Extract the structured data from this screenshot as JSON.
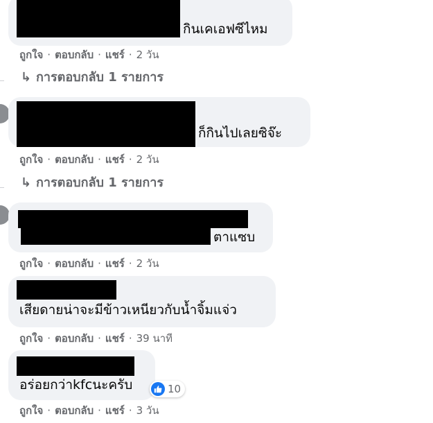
{
  "comments": [
    {
      "text": "กินเคเอฟซีไหม",
      "timestamp": "2 วัน",
      "replies_label": "การตอบกลับ 1 รายการ"
    },
    {
      "text": "ก็กินไปเลยซิจ๊ะ",
      "timestamp": "2 วัน",
      "replies_label": "การตอบกลับ 1 รายการ"
    },
    {
      "text": "ตาแซบ",
      "timestamp": "2 วัน"
    },
    {
      "text": "เสียดายน่าจะมีข้าวเหนียวกับน้ำจิ้มแจ่ว",
      "timestamp": "39 นาที"
    },
    {
      "text": "อร่อยกว่าkfcนะครับ",
      "timestamp": "3 วัน",
      "reaction_count": "10"
    }
  ],
  "actions": {
    "like": "ถูกใจ",
    "reply": "ตอบกลับ",
    "share": "แชร์",
    "separator": "·"
  },
  "reply_arrow": "↳",
  "colors": {
    "bubble": "#f0f2f5",
    "meta": "#65676b",
    "like_blue": "#1877f2",
    "redaction": "#000000"
  }
}
